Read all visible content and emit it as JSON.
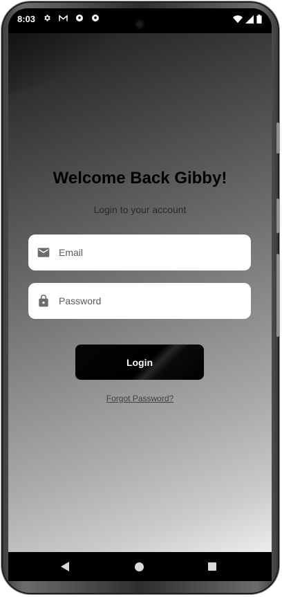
{
  "status_bar": {
    "time": "8:03",
    "notification_icons": [
      "settings-icon",
      "gmail-icon",
      "soccer-ball-icon",
      "soccer-ball-icon"
    ],
    "system_icons": [
      "wifi-icon",
      "signal-icon",
      "battery-icon"
    ]
  },
  "login": {
    "title": "Welcome Back Gibby!",
    "subtitle": "Login to your account",
    "email_placeholder": "Email",
    "email_value": "",
    "password_placeholder": "Password",
    "password_value": "",
    "login_label": "Login",
    "forgot_label": "Forgot Password?"
  },
  "colors": {
    "button_bg": "#000000",
    "field_bg": "#ffffff",
    "title_color": "#000000"
  },
  "nav_bar": {
    "buttons": [
      "back-icon",
      "home-icon",
      "recents-icon"
    ]
  }
}
